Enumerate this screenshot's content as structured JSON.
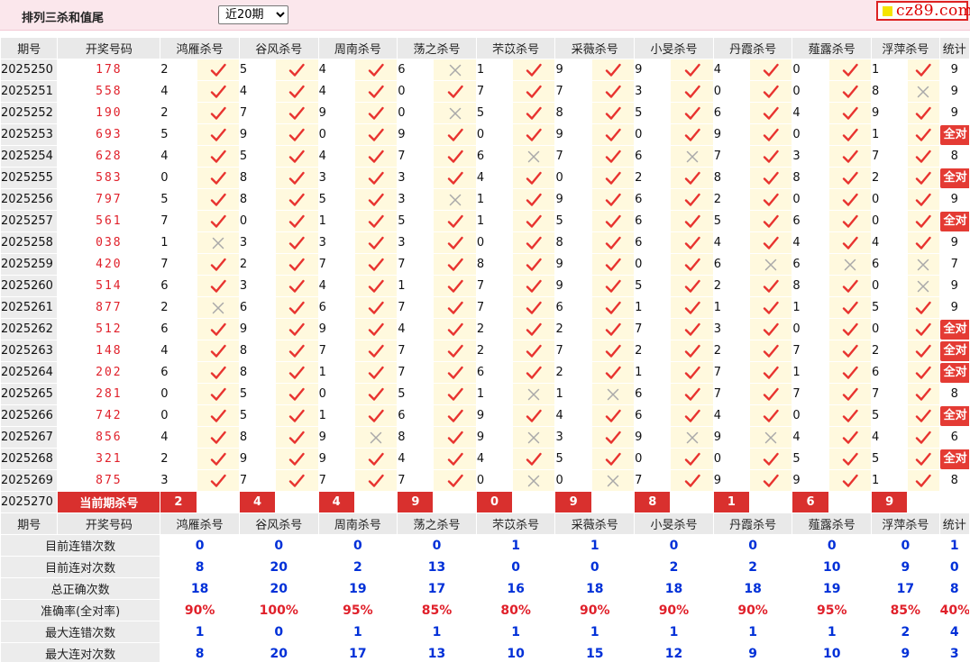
{
  "header": {
    "title": "排列三杀和值尾",
    "period_selected": "近20期",
    "period_options": [
      "近20期"
    ],
    "logo_text": "cz89.com"
  },
  "colors": {
    "accent": "#d9302e",
    "draw_number": "#e0202a",
    "stat_value": "#0030d8",
    "mark_bg": "#fff9de"
  },
  "columns": {
    "period": "期号",
    "draw": "开奖号码",
    "stat": "统计",
    "experts": [
      "鸿雁杀号",
      "谷风杀号",
      "周南杀号",
      "荡之杀号",
      "芣苡杀号",
      "采薇杀号",
      "小旻杀号",
      "丹霞杀号",
      "薤露杀号",
      "浮萍杀号"
    ]
  },
  "rows": [
    {
      "period": "2025250",
      "draw": "178",
      "kills": [
        "2",
        "5",
        "4",
        "6",
        "1",
        "9",
        "9",
        "4",
        "0",
        "1"
      ],
      "hits": [
        1,
        1,
        1,
        0,
        1,
        1,
        1,
        1,
        1,
        1
      ],
      "stat": "9"
    },
    {
      "period": "2025251",
      "draw": "558",
      "kills": [
        "4",
        "4",
        "4",
        "0",
        "7",
        "7",
        "3",
        "0",
        "0",
        "8"
      ],
      "hits": [
        1,
        1,
        1,
        1,
        1,
        1,
        1,
        1,
        1,
        0
      ],
      "stat": "9"
    },
    {
      "period": "2025252",
      "draw": "190",
      "kills": [
        "2",
        "7",
        "9",
        "0",
        "5",
        "8",
        "5",
        "6",
        "4",
        "9"
      ],
      "hits": [
        1,
        1,
        1,
        0,
        1,
        1,
        1,
        1,
        1,
        1
      ],
      "stat": "9"
    },
    {
      "period": "2025253",
      "draw": "693",
      "kills": [
        "5",
        "9",
        "0",
        "9",
        "0",
        "9",
        "0",
        "9",
        "0",
        "1"
      ],
      "hits": [
        1,
        1,
        1,
        1,
        1,
        1,
        1,
        1,
        1,
        1
      ],
      "stat": "全对"
    },
    {
      "period": "2025254",
      "draw": "628",
      "kills": [
        "4",
        "5",
        "4",
        "7",
        "6",
        "7",
        "6",
        "7",
        "3",
        "7"
      ],
      "hits": [
        1,
        1,
        1,
        1,
        0,
        1,
        0,
        1,
        1,
        1
      ],
      "stat": "8"
    },
    {
      "period": "2025255",
      "draw": "583",
      "kills": [
        "0",
        "8",
        "3",
        "3",
        "4",
        "0",
        "2",
        "8",
        "8",
        "2"
      ],
      "hits": [
        1,
        1,
        1,
        1,
        1,
        1,
        1,
        1,
        1,
        1
      ],
      "stat": "全对"
    },
    {
      "period": "2025256",
      "draw": "797",
      "kills": [
        "5",
        "8",
        "5",
        "3",
        "1",
        "9",
        "6",
        "2",
        "0",
        "0"
      ],
      "hits": [
        1,
        1,
        1,
        0,
        1,
        1,
        1,
        1,
        1,
        1
      ],
      "stat": "9"
    },
    {
      "period": "2025257",
      "draw": "561",
      "kills": [
        "7",
        "0",
        "1",
        "5",
        "1",
        "5",
        "6",
        "5",
        "6",
        "0"
      ],
      "hits": [
        1,
        1,
        1,
        1,
        1,
        1,
        1,
        1,
        1,
        1
      ],
      "stat": "全对"
    },
    {
      "period": "2025258",
      "draw": "038",
      "kills": [
        "1",
        "3",
        "3",
        "3",
        "0",
        "8",
        "6",
        "4",
        "4",
        "4"
      ],
      "hits": [
        0,
        1,
        1,
        1,
        1,
        1,
        1,
        1,
        1,
        1
      ],
      "stat": "9"
    },
    {
      "period": "2025259",
      "draw": "420",
      "kills": [
        "7",
        "2",
        "7",
        "7",
        "8",
        "9",
        "0",
        "6",
        "6",
        "6"
      ],
      "hits": [
        1,
        1,
        1,
        1,
        1,
        1,
        1,
        0,
        0,
        0
      ],
      "stat": "7"
    },
    {
      "period": "2025260",
      "draw": "514",
      "kills": [
        "6",
        "3",
        "4",
        "1",
        "7",
        "9",
        "5",
        "2",
        "8",
        "0"
      ],
      "hits": [
        1,
        1,
        1,
        1,
        1,
        1,
        1,
        1,
        1,
        0
      ],
      "stat": "9"
    },
    {
      "period": "2025261",
      "draw": "877",
      "kills": [
        "2",
        "6",
        "6",
        "7",
        "7",
        "6",
        "1",
        "1",
        "1",
        "5"
      ],
      "hits": [
        0,
        1,
        1,
        1,
        1,
        1,
        1,
        1,
        1,
        1
      ],
      "stat": "9"
    },
    {
      "period": "2025262",
      "draw": "512",
      "kills": [
        "6",
        "9",
        "9",
        "4",
        "2",
        "2",
        "7",
        "3",
        "0",
        "0"
      ],
      "hits": [
        1,
        1,
        1,
        1,
        1,
        1,
        1,
        1,
        1,
        1
      ],
      "stat": "全对"
    },
    {
      "period": "2025263",
      "draw": "148",
      "kills": [
        "4",
        "8",
        "7",
        "7",
        "2",
        "7",
        "2",
        "2",
        "7",
        "2"
      ],
      "hits": [
        1,
        1,
        1,
        1,
        1,
        1,
        1,
        1,
        1,
        1
      ],
      "stat": "全对"
    },
    {
      "period": "2025264",
      "draw": "202",
      "kills": [
        "6",
        "8",
        "1",
        "7",
        "6",
        "2",
        "1",
        "7",
        "1",
        "6"
      ],
      "hits": [
        1,
        1,
        1,
        1,
        1,
        1,
        1,
        1,
        1,
        1
      ],
      "stat": "全对"
    },
    {
      "period": "2025265",
      "draw": "281",
      "kills": [
        "0",
        "5",
        "0",
        "5",
        "1",
        "1",
        "6",
        "7",
        "7",
        "7"
      ],
      "hits": [
        1,
        1,
        1,
        1,
        0,
        0,
        1,
        1,
        1,
        1
      ],
      "stat": "8"
    },
    {
      "period": "2025266",
      "draw": "742",
      "kills": [
        "0",
        "5",
        "1",
        "6",
        "9",
        "4",
        "6",
        "4",
        "0",
        "5"
      ],
      "hits": [
        1,
        1,
        1,
        1,
        1,
        1,
        1,
        1,
        1,
        1
      ],
      "stat": "全对"
    },
    {
      "period": "2025267",
      "draw": "856",
      "kills": [
        "4",
        "8",
        "9",
        "8",
        "9",
        "3",
        "9",
        "9",
        "4",
        "4"
      ],
      "hits": [
        1,
        1,
        0,
        1,
        0,
        1,
        0,
        0,
        1,
        1
      ],
      "stat": "6"
    },
    {
      "period": "2025268",
      "draw": "321",
      "kills": [
        "2",
        "9",
        "9",
        "4",
        "4",
        "5",
        "0",
        "0",
        "5",
        "5"
      ],
      "hits": [
        1,
        1,
        1,
        1,
        1,
        1,
        1,
        1,
        1,
        1
      ],
      "stat": "全对"
    },
    {
      "period": "2025269",
      "draw": "875",
      "kills": [
        "3",
        "7",
        "7",
        "7",
        "0",
        "0",
        "7",
        "9",
        "9",
        "1"
      ],
      "hits": [
        1,
        1,
        1,
        1,
        0,
        0,
        1,
        1,
        1,
        1
      ],
      "stat": "8"
    }
  ],
  "current": {
    "period": "2025270",
    "label": "当前期杀号",
    "kills": [
      "2",
      "4",
      "4",
      "9",
      "0",
      "9",
      "8",
      "1",
      "6",
      "9"
    ]
  },
  "stats": [
    {
      "label": "目前连错次数",
      "values": [
        "0",
        "0",
        "0",
        "0",
        "1",
        "1",
        "0",
        "0",
        "0",
        "0"
      ],
      "total": "1",
      "red": false
    },
    {
      "label": "目前连对次数",
      "values": [
        "8",
        "20",
        "2",
        "13",
        "0",
        "0",
        "2",
        "2",
        "10",
        "9"
      ],
      "total": "0",
      "red": false
    },
    {
      "label": "总正确次数",
      "values": [
        "18",
        "20",
        "19",
        "17",
        "16",
        "18",
        "18",
        "18",
        "19",
        "17"
      ],
      "total": "8",
      "red": false
    },
    {
      "label": "准确率(全对率)",
      "values": [
        "90%",
        "100%",
        "95%",
        "85%",
        "80%",
        "90%",
        "90%",
        "90%",
        "95%",
        "85%"
      ],
      "total": "40%",
      "red": true
    },
    {
      "label": "最大连错次数",
      "values": [
        "1",
        "0",
        "1",
        "1",
        "1",
        "1",
        "1",
        "1",
        "1",
        "2"
      ],
      "total": "4",
      "red": false
    },
    {
      "label": "最大连对次数",
      "values": [
        "8",
        "20",
        "17",
        "13",
        "10",
        "15",
        "12",
        "9",
        "10",
        "9"
      ],
      "total": "3",
      "red": false
    }
  ]
}
